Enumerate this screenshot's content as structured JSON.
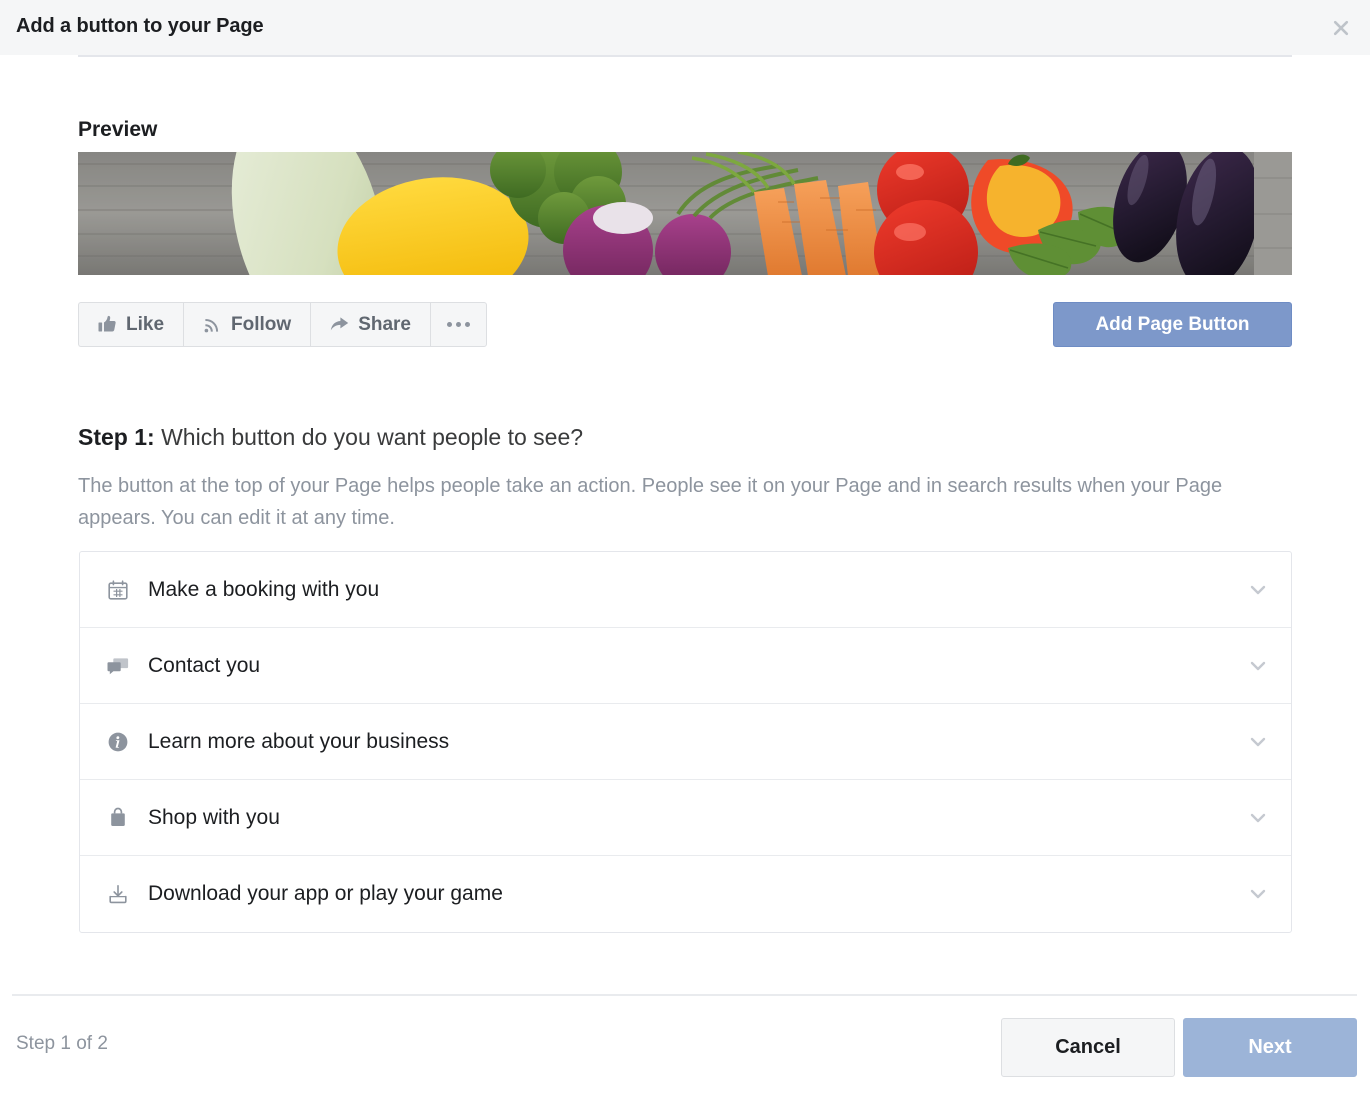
{
  "header": {
    "title": "Add a button to your Page",
    "close_icon": "close-icon"
  },
  "preview": {
    "label": "Preview",
    "cover_photo_alt": "vegetables-cover-photo",
    "actions": [
      {
        "label": "Like",
        "icon": "thumbs-up-icon"
      },
      {
        "label": "Follow",
        "icon": "rss-signal-icon"
      },
      {
        "label": "Share",
        "icon": "share-arrow-icon"
      },
      {
        "label": "",
        "icon": "ellipsis-icon"
      }
    ],
    "add_page_button_label": "Add Page Button",
    "add_page_button_color": "#7d98ca"
  },
  "step": {
    "heading_lead": "Step 1:",
    "heading_rest": " Which button do you want people to see?",
    "description": "The button at the top of your Page helps people take an action. People see it on your Page and in search results when your Page appears. You can edit it at any time."
  },
  "options": [
    {
      "label": "Make a booking with you",
      "icon": "calendar-icon",
      "chevron": "chevron-down-icon"
    },
    {
      "label": "Contact you",
      "icon": "speech-bubbles-icon",
      "chevron": "chevron-down-icon"
    },
    {
      "label": "Learn more about your business",
      "icon": "info-circle-icon",
      "chevron": "chevron-down-icon"
    },
    {
      "label": "Shop with you",
      "icon": "shopping-bag-icon",
      "chevron": "chevron-down-icon"
    },
    {
      "label": "Download your app or play your game",
      "icon": "download-icon",
      "chevron": "chevron-down-icon"
    }
  ],
  "footer": {
    "step_count": "Step 1 of 2",
    "cancel_label": "Cancel",
    "next_label": "Next",
    "next_color": "#9cb4d8"
  }
}
